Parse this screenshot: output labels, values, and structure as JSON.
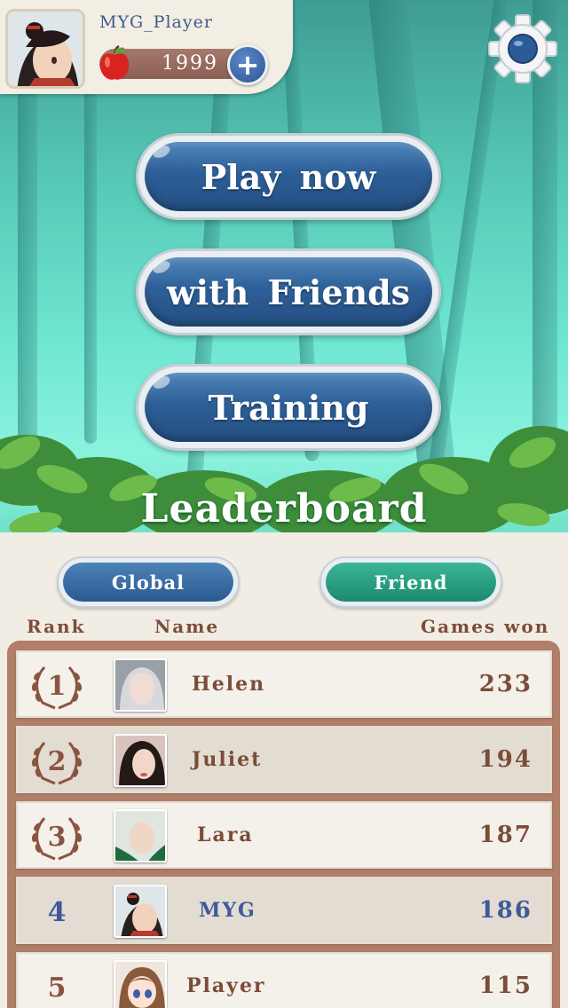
{
  "header": {
    "player_name": "MYG_Player",
    "coins": "1999",
    "add_coins_label": "+"
  },
  "menu": {
    "play_now": "Play now",
    "with_friends": "with Friends",
    "training": "Training"
  },
  "leaderboard": {
    "title": "Leaderboard",
    "tabs": {
      "global": "Global",
      "friend": "Friend"
    },
    "active_tab": "Friend",
    "columns": {
      "rank": "Rank",
      "name": "Name",
      "games_won": "Games won"
    },
    "rows": [
      {
        "rank": "1",
        "name": "Helen",
        "games_won": "233",
        "laurel": true,
        "me": false
      },
      {
        "rank": "2",
        "name": "Juliet",
        "games_won": "194",
        "laurel": true,
        "me": false
      },
      {
        "rank": "3",
        "name": "Lara",
        "games_won": "187",
        "laurel": true,
        "me": false
      },
      {
        "rank": "4",
        "name": "MYG",
        "games_won": "186",
        "laurel": false,
        "me": true
      },
      {
        "rank": "5",
        "name": "Player",
        "games_won": "115",
        "laurel": false,
        "me": false
      }
    ]
  },
  "colors": {
    "accent_blue": "#2d5f97",
    "accent_green": "#1c8a6c",
    "text_brown": "#7a4d38",
    "me_blue": "#3f5a9c"
  }
}
